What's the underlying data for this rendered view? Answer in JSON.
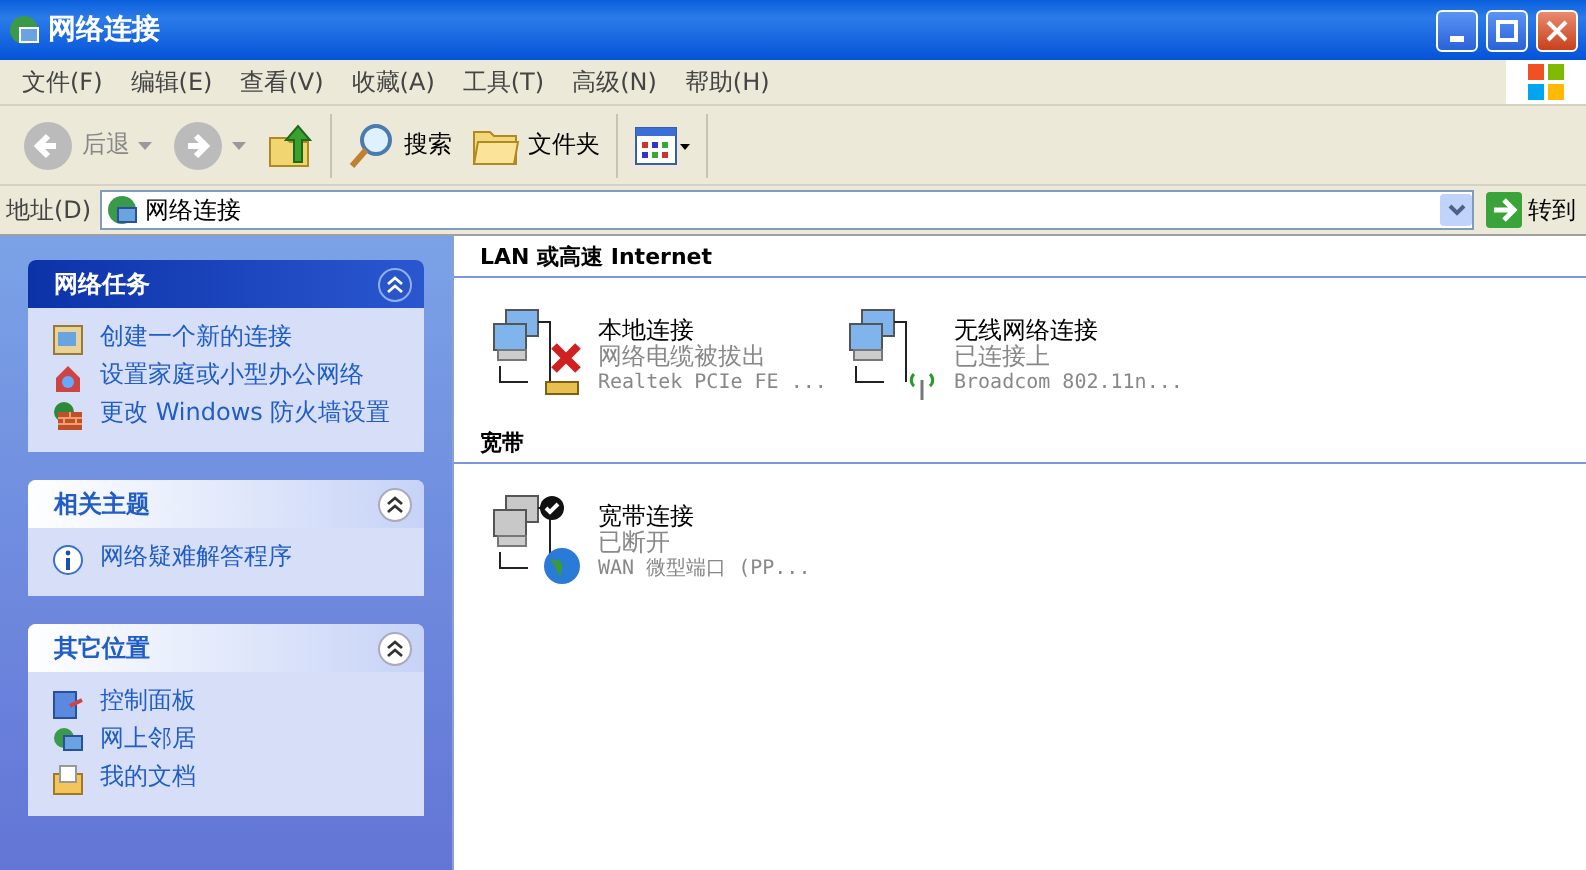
{
  "window": {
    "title": "网络连接"
  },
  "menu": [
    "文件(F)",
    "编辑(E)",
    "查看(V)",
    "收藏(A)",
    "工具(T)",
    "高级(N)",
    "帮助(H)"
  ],
  "toolbar": [
    {
      "kind": "back",
      "label": "后退",
      "disabled": true
    },
    {
      "kind": "forward",
      "disabled": true
    },
    {
      "kind": "up"
    },
    {
      "kind": "search",
      "label": "搜索"
    },
    {
      "kind": "folders",
      "label": "文件夹"
    },
    {
      "kind": "views"
    }
  ],
  "address": {
    "label": "地址(D)",
    "value": "网络连接",
    "go": "转到"
  },
  "sidebar": [
    {
      "kind": "primary",
      "title": "网络任务",
      "items": [
        "创建一个新的连接",
        "设置家庭或小型办公网络",
        "更改 Windows 防火墙设置"
      ]
    },
    {
      "kind": "normal",
      "title": "相关主题",
      "items": [
        "网络疑难解答程序"
      ]
    },
    {
      "kind": "normal",
      "title": "其它位置",
      "items": [
        "控制面板",
        "网上邻居",
        "我的文档"
      ]
    }
  ],
  "sections": [
    {
      "title": "LAN 或高速 Internet",
      "connections": [
        {
          "kind": "lan-unplugged",
          "name": "本地连接",
          "status": "网络电缆被拔出",
          "device": "Realtek PCIe FE ..."
        },
        {
          "kind": "wireless",
          "name": "无线网络连接",
          "status": "已连接上",
          "device": "Broadcom 802.11n..."
        }
      ]
    },
    {
      "title": "宽带",
      "connections": [
        {
          "kind": "broadband",
          "name": "宽带连接",
          "status": "已断开",
          "device": "WAN 微型端口 (PP..."
        }
      ]
    }
  ]
}
